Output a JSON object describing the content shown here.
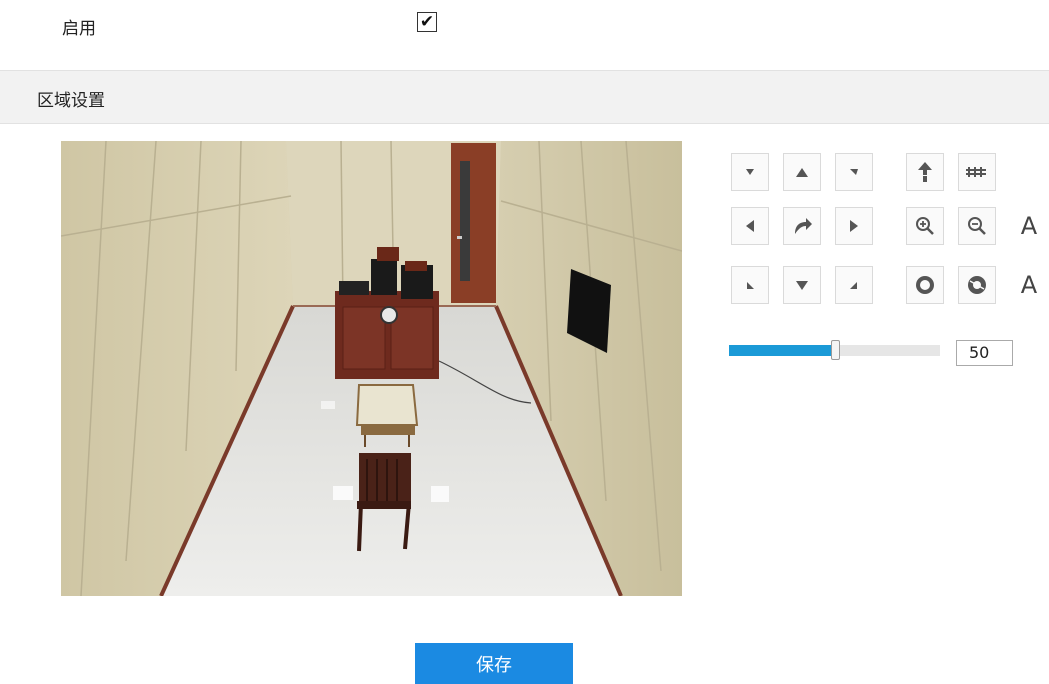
{
  "enable": {
    "label": "启用",
    "checked": true,
    "check_glyph": "✔"
  },
  "region": {
    "title": "区域设置"
  },
  "video": {
    "alt": "camera-live-view"
  },
  "ptz": {
    "controls": [
      {
        "name": "pan-up-left",
        "icon": "arrow-up-left-icon"
      },
      {
        "name": "tilt-up",
        "icon": "arrow-up-icon"
      },
      {
        "name": "pan-up-right",
        "icon": "arrow-up-right-icon"
      },
      {
        "name": "pan-left",
        "icon": "arrow-left-icon"
      },
      {
        "name": "auto-scan",
        "icon": "rotate-icon"
      },
      {
        "name": "pan-right",
        "icon": "arrow-right-icon"
      },
      {
        "name": "pan-down-left",
        "icon": "arrow-down-left-icon"
      },
      {
        "name": "tilt-down",
        "icon": "arrow-down-icon"
      },
      {
        "name": "pan-down-right",
        "icon": "arrow-down-right-icon"
      },
      {
        "name": "focus-near",
        "icon": "focus-near-icon"
      },
      {
        "name": "focus-far",
        "icon": "focus-far-icon"
      },
      {
        "name": "zoom-in",
        "icon": "zoom-in-icon"
      },
      {
        "name": "zoom-out",
        "icon": "zoom-out-icon"
      },
      {
        "name": "iris-open",
        "icon": "iris-open-icon"
      },
      {
        "name": "iris-close",
        "icon": "iris-close-icon"
      }
    ],
    "auto_letter_1": "A",
    "auto_letter_2": "A",
    "speed": {
      "value": 50,
      "min": 0,
      "max": 100,
      "fill_fraction": 0.5
    }
  },
  "actions": {
    "save_label": "保存"
  },
  "colors": {
    "accent": "#1b8ae2",
    "slider": "#1b9ad7"
  }
}
